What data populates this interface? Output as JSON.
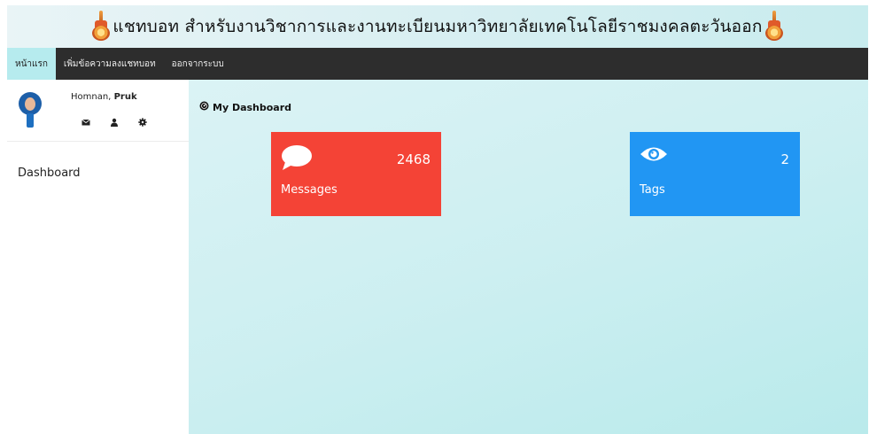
{
  "banner": {
    "title": "แชทบอท สำหรับงานวิชาการและงานทะเบียนมหาวิทยาลัยเทคโนโลยีราชมงคลตะวันออก"
  },
  "navbar": {
    "items": [
      {
        "label": "หน้าแรก",
        "active": true
      },
      {
        "label": "เพิ่มข้อความลงแชทบอท",
        "active": false
      },
      {
        "label": "ออกจากระบบ",
        "active": false
      }
    ]
  },
  "sidebar": {
    "user": {
      "last_name": "Homnan,",
      "first_name": "Pruk"
    },
    "icons": [
      "envelope-icon",
      "user-icon",
      "cog-icon"
    ],
    "links": [
      {
        "label": "Dashboard"
      }
    ]
  },
  "main": {
    "title": "My Dashboard",
    "cards": [
      {
        "label": "Messages",
        "count": "2468",
        "icon": "comment-icon",
        "color": "#f44336"
      },
      {
        "label": "Tags",
        "count": "2",
        "icon": "eye-icon",
        "color": "#2196f3"
      }
    ]
  },
  "colors": {
    "navbar_bg": "#2d2d2d",
    "nav_active_bg": "#b6ebee",
    "main_bg": "#cdeff1"
  }
}
